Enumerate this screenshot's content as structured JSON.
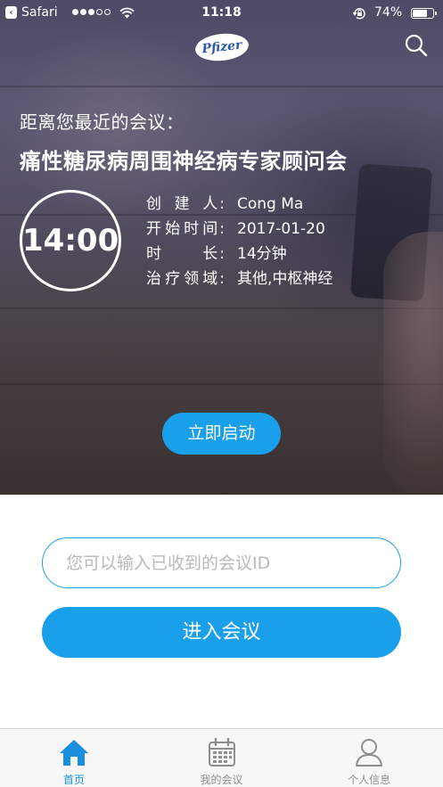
{
  "status_bar": {
    "back_app": "Safari",
    "time": "11:18",
    "battery": "74%",
    "battery_level": 0.74,
    "signal_bars_filled": 3,
    "signal_bars_total": 5
  },
  "header": {
    "logo_text": "Pfizer",
    "search_icon": "search-icon"
  },
  "upcoming": {
    "caption": "距离您最近的会议：",
    "title": "痛性糖尿病周围神经病专家顾问会",
    "time": "14:00",
    "details": [
      {
        "label": "创建人",
        "value": "Cong Ma"
      },
      {
        "label": "开始时间",
        "value": "2017-01-20"
      },
      {
        "label": "时长",
        "value": "14分钟"
      },
      {
        "label": "治疗领域",
        "value": "其他,中枢神经"
      }
    ],
    "start_button": "立即启动"
  },
  "join": {
    "placeholder": "您可以输入已收到的会议ID",
    "value": "",
    "join_button": "进入会议"
  },
  "tab_bar": {
    "tabs": [
      {
        "label": "首页",
        "icon": "home-icon",
        "active": true
      },
      {
        "label": "我的会议",
        "icon": "calendar-icon",
        "active": false
      },
      {
        "label": "个人信息",
        "icon": "user-icon",
        "active": false
      }
    ]
  },
  "colors": {
    "accent": "#1aa0ea",
    "tab_active": "#1a8fe0",
    "tab_inactive": "#8e8e8e"
  }
}
